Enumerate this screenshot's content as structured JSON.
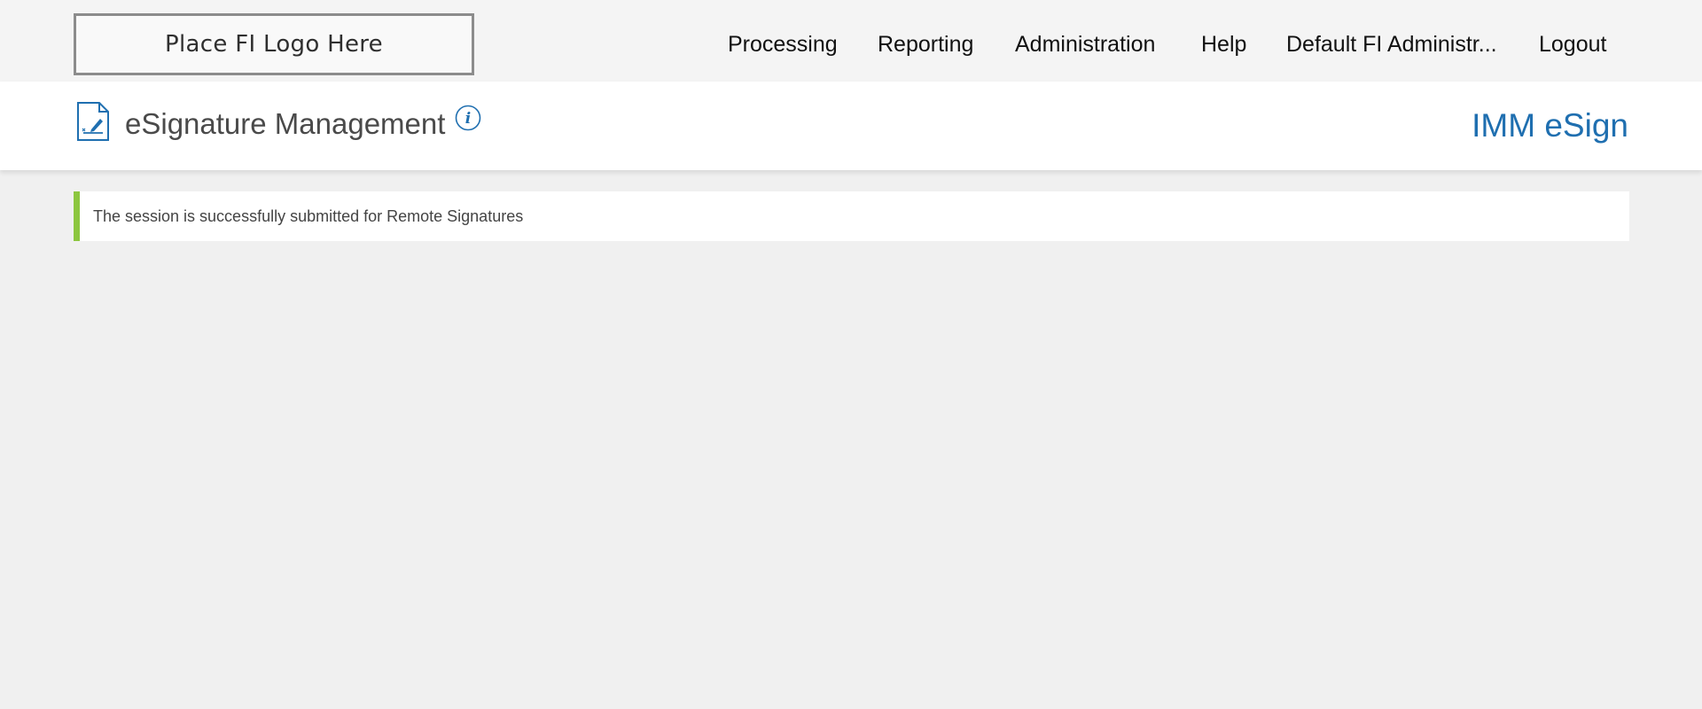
{
  "logo": {
    "text": "Place FI Logo Here"
  },
  "nav": {
    "items": [
      {
        "label": "Processing"
      },
      {
        "label": "Reporting"
      },
      {
        "label": "Administration"
      },
      {
        "label": "Help"
      },
      {
        "label": "Default FI Administr..."
      },
      {
        "label": "Logout"
      }
    ]
  },
  "header": {
    "title": "eSignature Management",
    "app_name": "IMM eSign",
    "icon": "document-signature-icon",
    "info_icon": "info-icon"
  },
  "alert": {
    "message": "The session is successfully submitted for Remote Signatures",
    "status_color": "#8cc63f"
  },
  "colors": {
    "accent": "#1f6fb0",
    "success": "#8cc63f",
    "background": "#f0f0f0"
  }
}
